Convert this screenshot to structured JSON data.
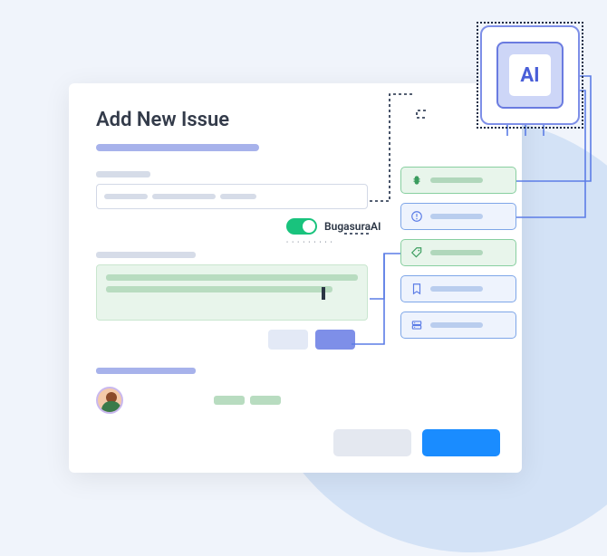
{
  "panel": {
    "title": "Add New Issue"
  },
  "toggle": {
    "label": "BugasuraAI",
    "on": true
  },
  "ai_chip": {
    "label": "AI"
  },
  "suggestions": [
    {
      "icon": "bug-icon",
      "style": "green"
    },
    {
      "icon": "alert-icon",
      "style": "blue"
    },
    {
      "icon": "tag-icon",
      "style": "green"
    },
    {
      "icon": "bookmark-icon",
      "style": "blue"
    },
    {
      "icon": "server-icon",
      "style": "blue"
    }
  ],
  "footer": {
    "cancel": "",
    "submit": ""
  }
}
